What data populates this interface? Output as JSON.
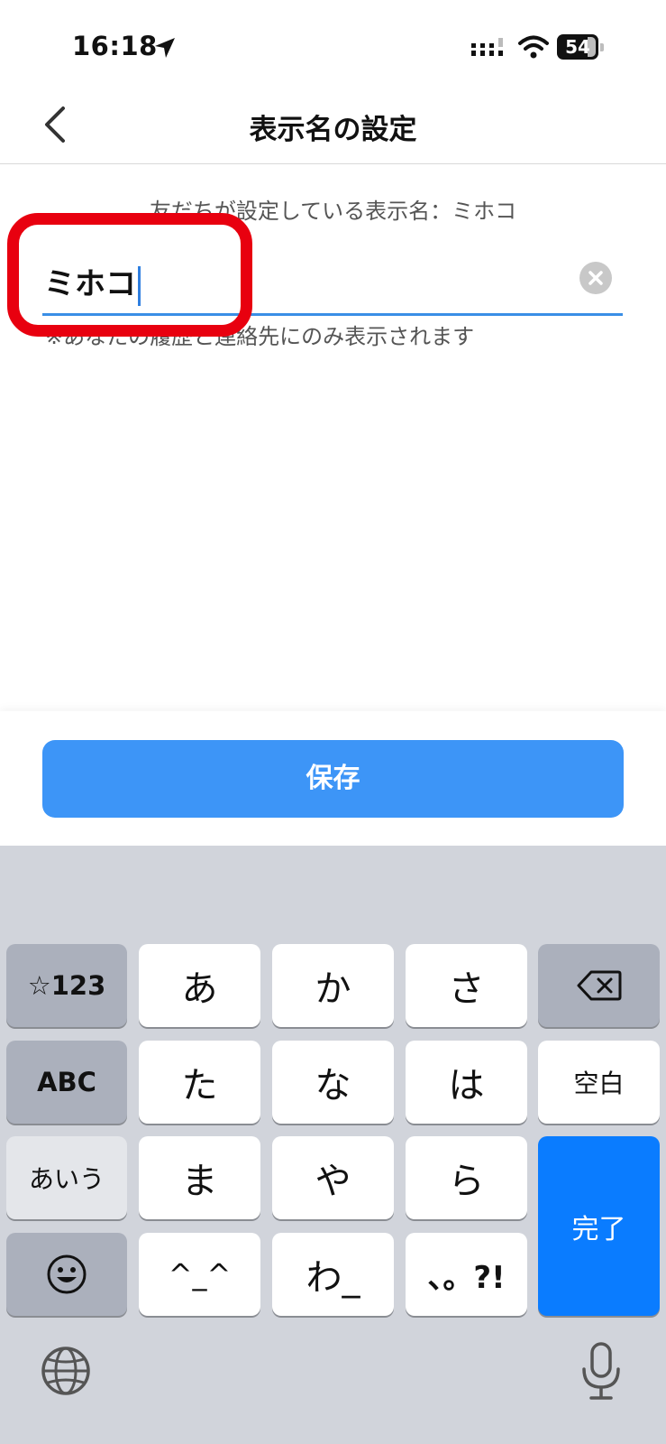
{
  "status_bar": {
    "time": "16:18",
    "battery": "54"
  },
  "header": {
    "title": "表示名の設定"
  },
  "content": {
    "friend_name_line": "友だちが設定している表示名：ミホコ",
    "input_value": "ミホコ",
    "note": "※あなたの履歴と連絡先にのみ表示されます"
  },
  "save_button": {
    "label": "保存"
  },
  "keyboard": {
    "row1": [
      "☆123",
      "あ",
      "か",
      "さ"
    ],
    "row2": [
      "ABC",
      "た",
      "な",
      "は",
      "空白"
    ],
    "row3": [
      "あいう",
      "ま",
      "や",
      "ら"
    ],
    "row4": [
      "^_^",
      "わ_",
      "、。?!"
    ],
    "done": "完了"
  },
  "colors": {
    "accent": "#3d95f7",
    "highlight": "#e8000f",
    "keyboard_blue": "#0a7cff"
  }
}
